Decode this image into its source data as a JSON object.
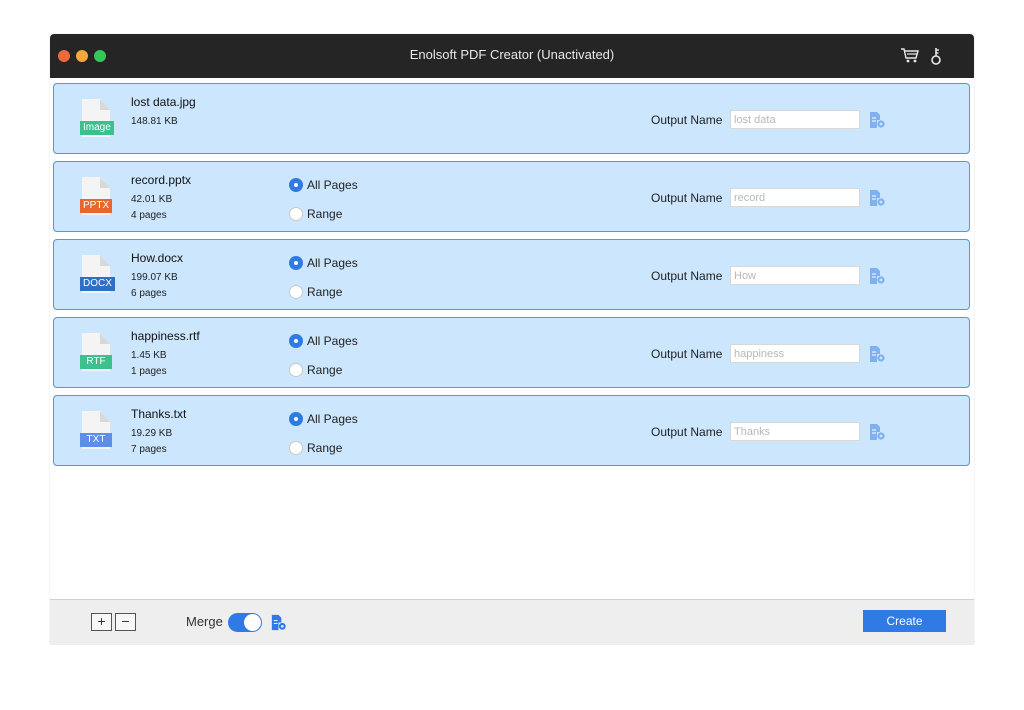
{
  "window": {
    "title": "Enolsoft PDF Creator (Unactivated)",
    "traffic_lights": [
      "close",
      "minimize",
      "zoom"
    ],
    "toolbar_icons": [
      "cart-icon",
      "key-icon"
    ]
  },
  "colors": {
    "titlebar": "#252525",
    "row_background": "#cbe6fd",
    "row_border": "#4f97e8",
    "accent": "#2f7ae5",
    "tag_image": "#3dc08e",
    "tag_pptx": "#e8672d",
    "tag_docx": "#2e6fc8",
    "tag_rtf": "#3dc08e",
    "tag_txt": "#5d8fe8"
  },
  "files": [
    {
      "name": "lost data.jpg",
      "size": "148.81 KB",
      "pages": "",
      "type": "Image",
      "output_label": "Output Name",
      "output_placeholder": "lost data",
      "has_range": false
    },
    {
      "name": "record.pptx",
      "size": "42.01 KB",
      "pages": "4 pages",
      "type": "PPTX",
      "all_pages": "All Pages",
      "range": "Range",
      "selected": "All Pages",
      "output_label": "Output Name",
      "output_placeholder": "record",
      "has_range": true
    },
    {
      "name": "How.docx",
      "size": "199.07 KB",
      "pages": "6 pages",
      "type": "DOCX",
      "all_pages": "All Pages",
      "range": "Range",
      "selected": "All Pages",
      "output_label": "Output Name",
      "output_placeholder": "How",
      "has_range": true
    },
    {
      "name": "happiness.rtf",
      "size": "1.45 KB",
      "pages": "1 pages",
      "type": "RTF",
      "all_pages": "All Pages",
      "range": "Range",
      "selected": "All Pages",
      "output_label": "Output Name",
      "output_placeholder": "happiness",
      "has_range": true
    },
    {
      "name": "Thanks.txt",
      "size": "19.29 KB",
      "pages": "7 pages",
      "type": "TXT",
      "all_pages": "All Pages",
      "range": "Range",
      "selected": "All Pages",
      "output_label": "Output Name",
      "output_placeholder": "Thanks",
      "has_range": true
    }
  ],
  "bottom": {
    "add_label": "+",
    "remove_label": "−",
    "merge_label": "Merge",
    "merge_on": true,
    "create_label": "Create"
  }
}
